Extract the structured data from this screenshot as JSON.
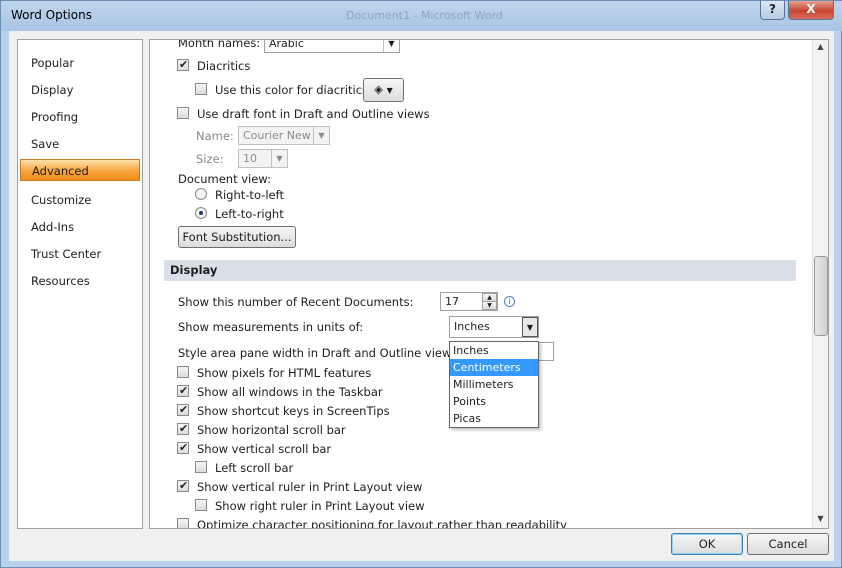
{
  "window": {
    "title": "Word Options",
    "background_title": "Document1 - Microsoft Word",
    "help_label": "?",
    "close_label": "X"
  },
  "nav": {
    "items": [
      {
        "label": "Popular"
      },
      {
        "label": "Display"
      },
      {
        "label": "Proofing"
      },
      {
        "label": "Save"
      },
      {
        "label": "Advanced",
        "active": true
      },
      {
        "label": "Customize"
      },
      {
        "label": "Add-Ins"
      },
      {
        "label": "Trust Center"
      },
      {
        "label": "Resources"
      }
    ]
  },
  "content": {
    "month_names_label": "Month names:",
    "month_names_value": "Arabic",
    "diacritics_label": "Diacritics",
    "diacritics_color_label": "Use this color for diacritics",
    "draft_font_label": "Use draft font in Draft and Outline views",
    "name_label": "Name:",
    "name_value": "Courier New",
    "size_label": "Size:",
    "size_value": "10",
    "doc_view_label": "Document view:",
    "rtl_label": "Right-to-left",
    "ltr_label": "Left-to-right",
    "font_sub_label": "Font Substitution...",
    "section_title": "Display",
    "recent_docs_label": "Show this number of Recent Documents:",
    "recent_docs_value": "17",
    "units_label": "Show measurements in units of:",
    "units_value": "Inches",
    "style_area_label": "Style area pane width in Draft and Outline views:",
    "units_options": [
      "Inches",
      "Centimeters",
      "Millimeters",
      "Points",
      "Picas"
    ],
    "units_highlighted": "Centimeters",
    "options": [
      {
        "label": "Show pixels for HTML features",
        "checked": false
      },
      {
        "label": "Show all windows in the Taskbar",
        "checked": true
      },
      {
        "label": "Show shortcut keys in ScreenTips",
        "checked": true
      },
      {
        "label": "Show horizontal scroll bar",
        "checked": true
      },
      {
        "label": "Show vertical scroll bar",
        "checked": true
      },
      {
        "label": "Left scroll bar",
        "checked": false
      },
      {
        "label": "Show vertical ruler in Print Layout view",
        "checked": true
      },
      {
        "label": "Show right ruler in Print Layout view",
        "checked": false
      },
      {
        "label": "Optimize character positioning for layout rather than readability",
        "checked": false
      }
    ]
  },
  "footer": {
    "ok_label": "OK",
    "cancel_label": "Cancel"
  }
}
